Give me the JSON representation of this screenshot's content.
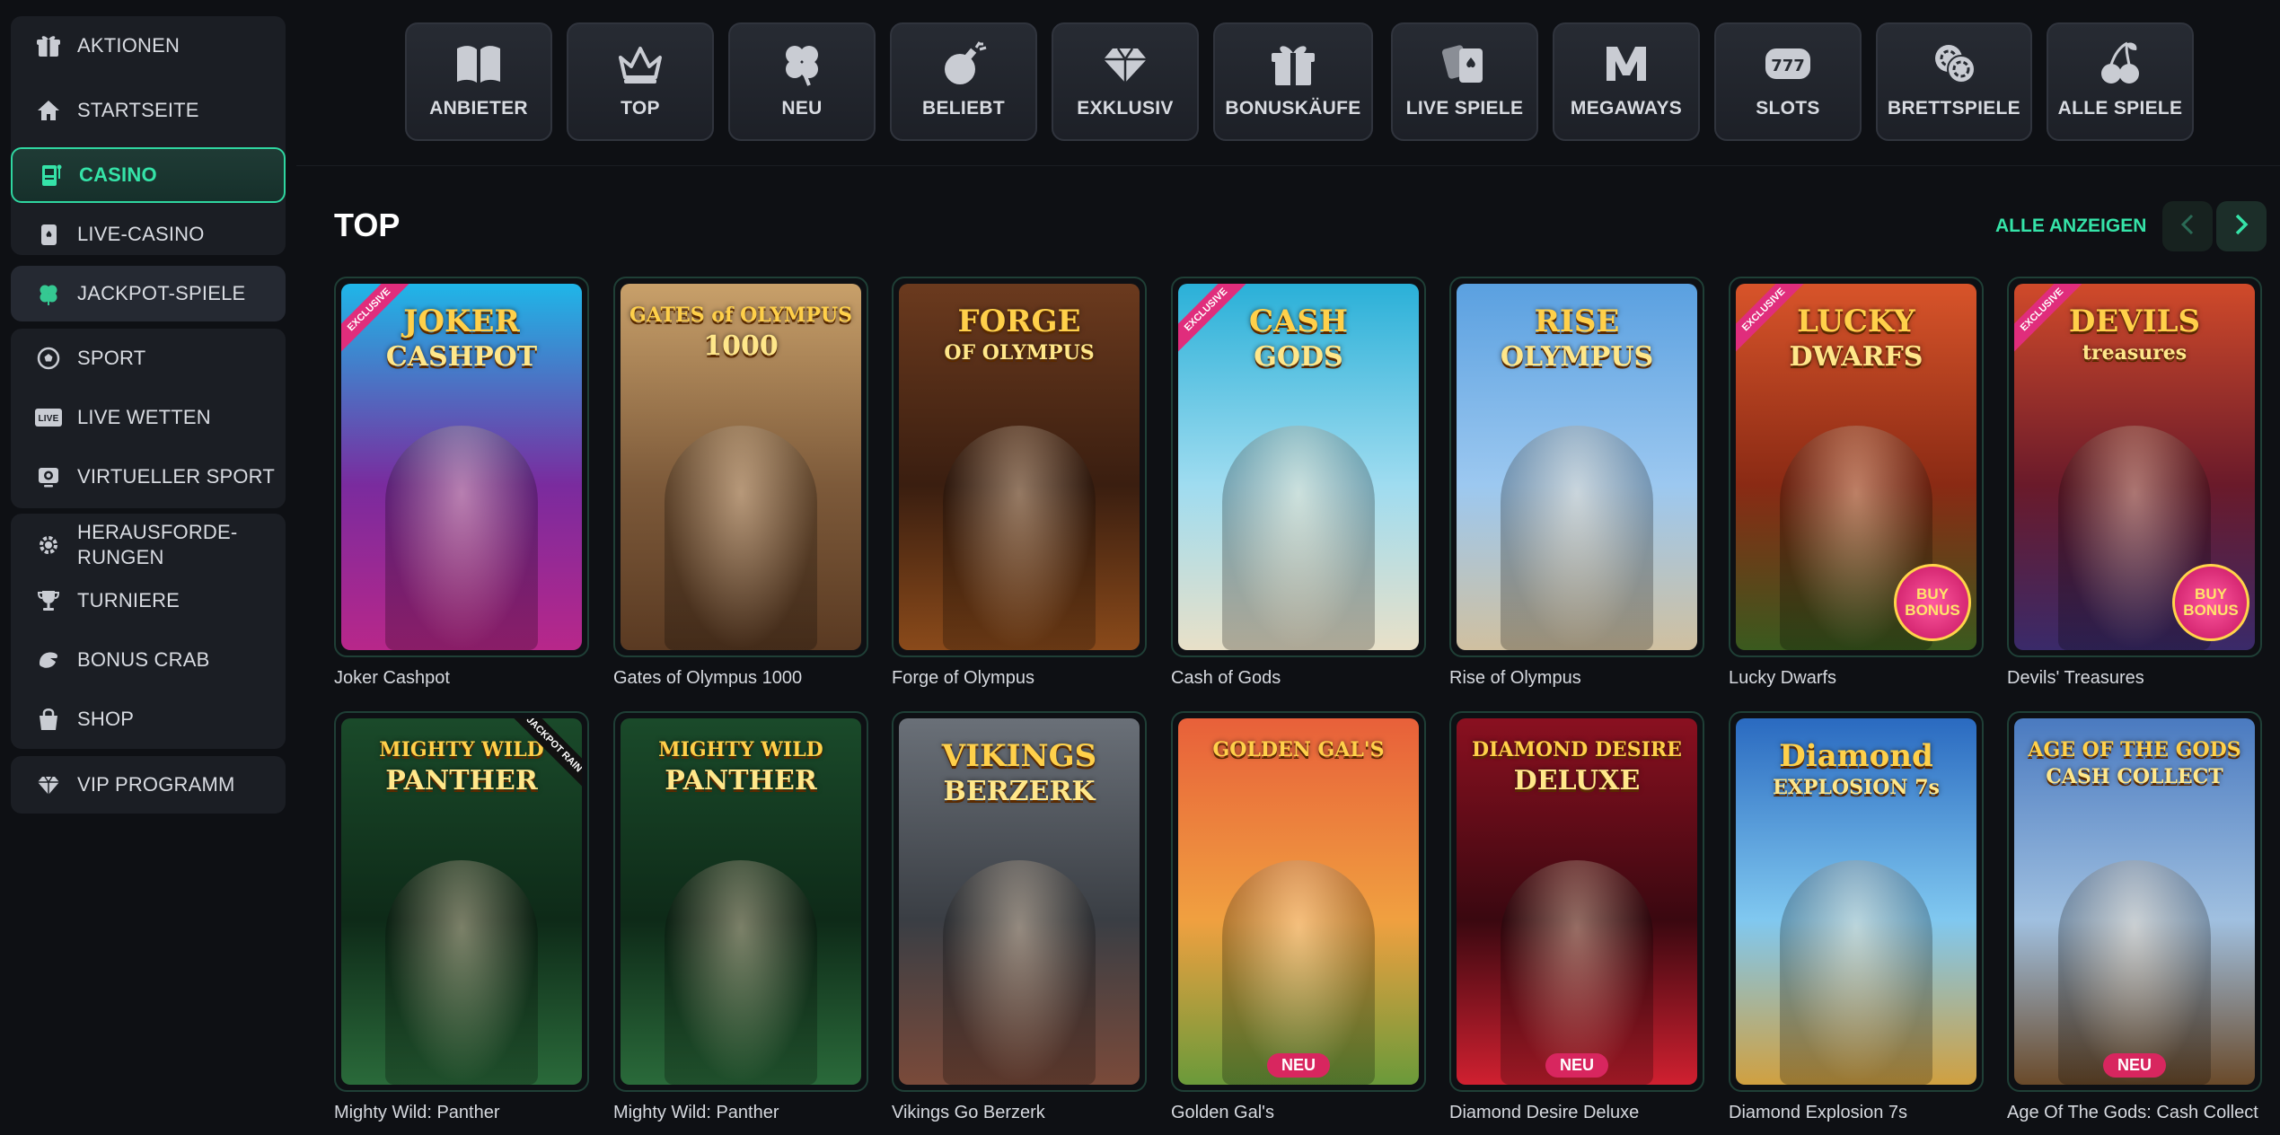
{
  "sidebar": {
    "items": [
      {
        "label": "AKTIONEN",
        "icon": "gift-icon"
      },
      {
        "label": "STARTSEITE",
        "icon": "home-icon"
      },
      {
        "label": "CASINO",
        "icon": "slot-machine-icon"
      },
      {
        "label": "LIVE-CASINO",
        "icon": "playing-card-icon"
      },
      {
        "label": "JACKPOT-SPIELE",
        "icon": "clover-icon"
      },
      {
        "label": "SPORT",
        "icon": "soccer-ball-icon"
      },
      {
        "label": "LIVE WETTEN",
        "icon": "live-badge-icon"
      },
      {
        "label": "VIRTUELLER SPORT",
        "icon": "virtual-sport-icon"
      },
      {
        "label_line1": "HERAUSFORDE-",
        "label_line2": "RUNGEN",
        "icon": "challenge-gear-icon"
      },
      {
        "label": "TURNIERE",
        "icon": "trophy-icon"
      },
      {
        "label": "BONUS CRAB",
        "icon": "crab-claw-icon"
      },
      {
        "label": "SHOP",
        "icon": "shopping-bag-icon"
      },
      {
        "label": "VIP PROGRAMM",
        "icon": "diamond-icon"
      }
    ]
  },
  "categories": [
    {
      "label": "ANBIETER",
      "icon": "book-icon"
    },
    {
      "label": "TOP",
      "icon": "crown-icon"
    },
    {
      "label": "NEU",
      "icon": "clover-icon"
    },
    {
      "label": "BELIEBT",
      "icon": "bomb-icon"
    },
    {
      "label": "EXKLUSIV",
      "icon": "diamond-icon"
    },
    {
      "label": "BONUSKÄUFE",
      "icon": "gift-icon"
    },
    {
      "label": "LIVE SPIELE",
      "icon": "cards-icon"
    },
    {
      "label": "MEGAWAYS",
      "icon": "megaways-m-icon"
    },
    {
      "label": "SLOTS",
      "icon": "777-icon"
    },
    {
      "label": "BRETTSPIELE",
      "icon": "chips-icon"
    },
    {
      "label": "ALLE SPIELE",
      "icon": "cherries-icon"
    }
  ],
  "section": {
    "title": "TOP",
    "see_all": "ALLE ANZEIGEN"
  },
  "games": [
    {
      "name": "Joker Cashpot",
      "logo1": "JOKER",
      "logo2": "CASHPOT",
      "ribbon": "EXCLUSIVE",
      "badge": "",
      "colors": [
        "#1fb6e8",
        "#7a2b9e",
        "#b8278a"
      ]
    },
    {
      "name": "Gates of Olympus 1000",
      "logo1": "GATES of OLYMPUS",
      "logo2": "1000",
      "ribbon": "",
      "badge": "",
      "colors": [
        "#c8a06a",
        "#7d5a3a",
        "#5a3a22"
      ]
    },
    {
      "name": "Forge of Olympus",
      "logo1": "FORGE",
      "logo2": "OF OLYMPUS",
      "ribbon": "",
      "badge": "",
      "colors": [
        "#6b3a1e",
        "#3a1e10",
        "#8a4a1a"
      ]
    },
    {
      "name": "Cash of Gods",
      "logo1": "CASH",
      "logo2": "GODS",
      "ribbon": "EXCLUSIVE",
      "badge": "",
      "colors": [
        "#2ab0d8",
        "#9fdcf0",
        "#e8e0c8"
      ]
    },
    {
      "name": "Rise of Olympus",
      "logo1": "RISE",
      "logo2": "OLYMPUS",
      "ribbon": "",
      "badge": "",
      "colors": [
        "#5aa0e0",
        "#9cc8f0",
        "#d0c0a0"
      ]
    },
    {
      "name": "Lucky Dwarfs",
      "logo1": "LUCKY",
      "logo2": "DWARFS",
      "ribbon": "EXCLUSIVE",
      "badge": "BUY BONUS",
      "colors": [
        "#d8542a",
        "#8a2a14",
        "#3a5a1e"
      ]
    },
    {
      "name": "Devils' Treasures",
      "logo1": "DEVILS",
      "logo2": "treasures",
      "ribbon": "EXCLUSIVE",
      "badge": "BUY BONUS",
      "colors": [
        "#d04a2a",
        "#6a1a2a",
        "#3a2a6a"
      ]
    },
    {
      "name": "Mighty Wild: Panther",
      "logo1": "MIGHTY WILD",
      "logo2": "PANTHER",
      "ribbon": "JACKPOT RAIN",
      "badge": "",
      "colors": [
        "#1a4a2a",
        "#0e2a18",
        "#2a6a3a"
      ]
    },
    {
      "name": "Mighty Wild: Panther",
      "logo1": "MIGHTY WILD",
      "logo2": "PANTHER",
      "ribbon": "",
      "badge": "",
      "colors": [
        "#1a4a2a",
        "#0e2a18",
        "#2a6a3a"
      ]
    },
    {
      "name": "Vikings Go Berzerk",
      "logo1": "VIKINGS",
      "logo2": "BERZERK",
      "ribbon": "",
      "badge": "",
      "colors": [
        "#6a7078",
        "#3a3e44",
        "#7a4a3a"
      ]
    },
    {
      "name": "Golden Gal's",
      "logo1": "GOLDEN GAL'S",
      "logo2": "",
      "ribbon": "",
      "badge": "NEU",
      "colors": [
        "#e8603a",
        "#f0a040",
        "#6a9a3a"
      ]
    },
    {
      "name": "Diamond Desire Deluxe",
      "logo1": "DIAMOND DESIRE",
      "logo2": "DELUXE",
      "ribbon": "",
      "badge": "NEU",
      "colors": [
        "#8a1020",
        "#3a0810",
        "#d02030"
      ]
    },
    {
      "name": "Diamond Explosion 7s",
      "logo1": "Diamond",
      "logo2": "EXPLOSION 7s",
      "ribbon": "",
      "badge": "",
      "colors": [
        "#2a6ac0",
        "#80c8f0",
        "#d0a040"
      ]
    },
    {
      "name": "Age Of The Gods: Cash Collect",
      "logo1": "AGE OF THE GODS",
      "logo2": "CASH COLLECT",
      "ribbon": "",
      "badge": "NEU",
      "colors": [
        "#4a7ac0",
        "#a0c0e0",
        "#6a4a2a"
      ]
    }
  ]
}
